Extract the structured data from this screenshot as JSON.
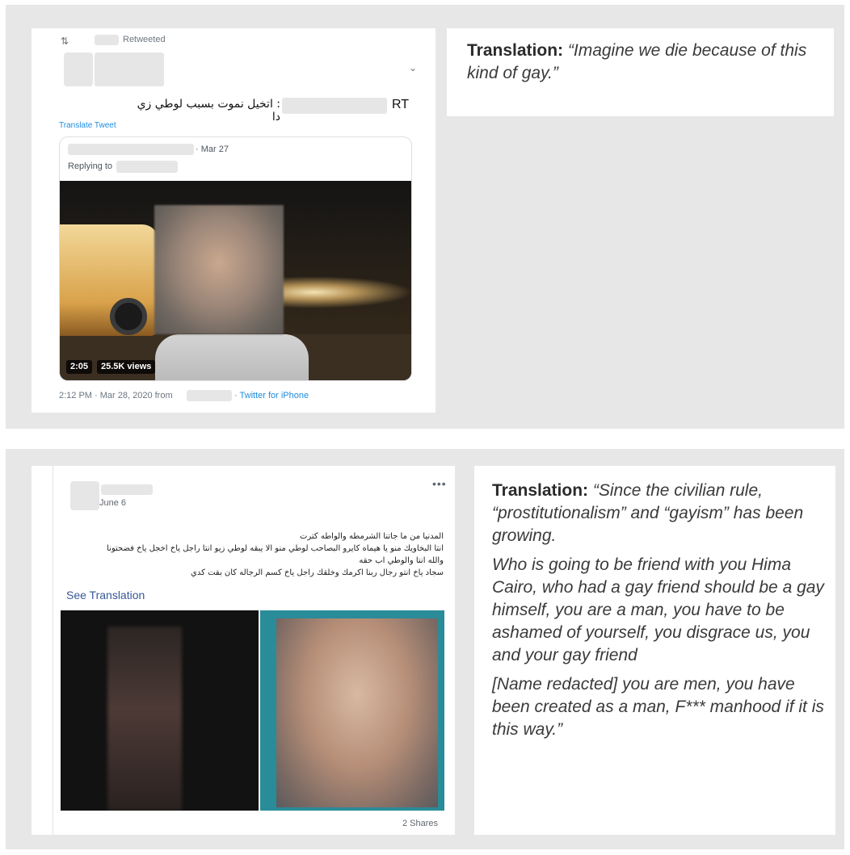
{
  "tweet": {
    "retweeted_label": "Retweeted",
    "tweet_text": ": اتخيل نموت بسبب لوطي زي دا",
    "rt_label": "RT",
    "translate_link": "Translate Tweet",
    "quote_date": "· Mar 27",
    "replying_to": "Replying to",
    "video_duration": "2:05",
    "video_views": "25.5K views",
    "timestamp": "2:12 PM · Mar 28, 2020 from",
    "source": "· Twitter for iPhone"
  },
  "translation1": {
    "label": "Translation:",
    "text": "“Imagine we die because of this kind of gay.”"
  },
  "facebook": {
    "date": "June 6",
    "line1": "المدنيا من ما جاتنا الشرمطه والواطه كترت",
    "line2": "انتا البخاويك منو يا هيماه كايرو البصاحب لوطي منو الا يبقه لوطي زيو انتا راجل ياخ اخجل ياخ فضحتونا",
    "line3": "والله انتا والوطي اب حقه",
    "line4": "سجاد ياخ انتو رجال ربنا اكرمك وخلقك راجل ياخ كسم الرجاله كان بقت كدي",
    "see_translation": "See Translation",
    "shares": "2 Shares"
  },
  "translation2": {
    "label": "Translation:",
    "p1": "“Since the civilian rule, “prostitutionalism” and “gayism” has been growing.",
    "p2": "Who is going to be friend with you Hima Cairo, who had a gay friend should be a gay himself, you are a man, you have to be ashamed of yourself, you disgrace us, you and your gay friend",
    "p3": "[Name redacted] you are men, you have been created as a man, F*** manhood if it is this way.”"
  }
}
